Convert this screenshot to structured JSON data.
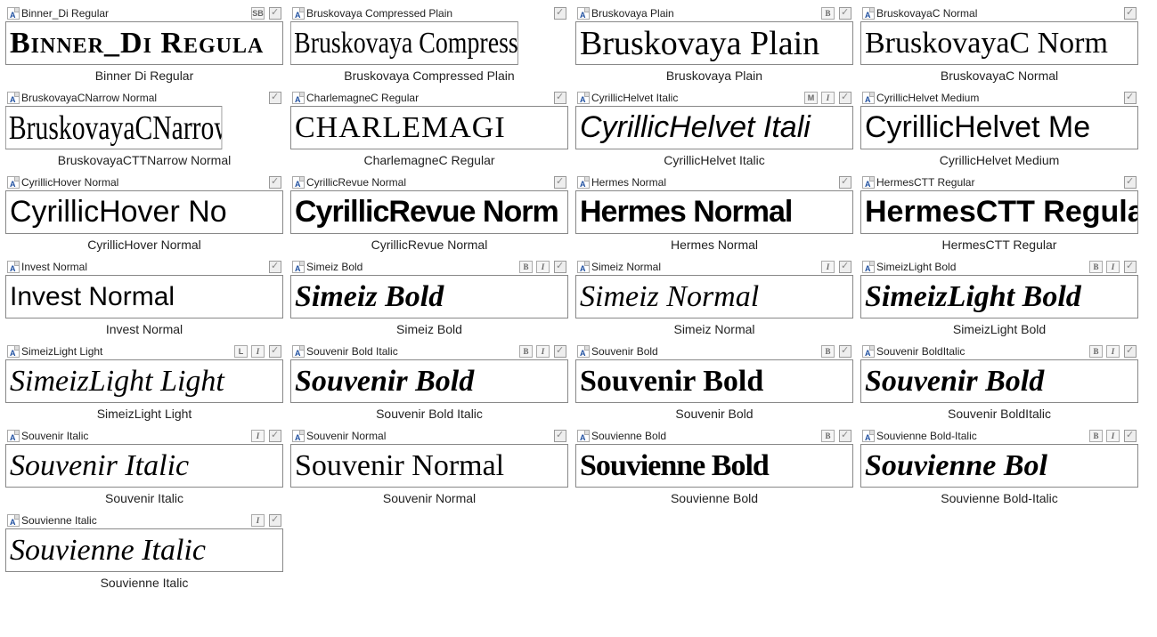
{
  "fonts": [
    {
      "title": "Binner_Di Regular",
      "preview": "Binner_Di Regula",
      "caption": "Binner Di Regular",
      "cls": "f-binner",
      "badges": [
        "SB"
      ]
    },
    {
      "title": "Bruskovaya Compressed Plain",
      "preview": "Bruskovaya Compressed Pla",
      "caption": "Bruskovaya Compressed Plain",
      "cls": "f-bruskcomp",
      "badges": []
    },
    {
      "title": "Bruskovaya Plain",
      "preview": "Bruskovaya Plain",
      "caption": "Bruskovaya Plain",
      "cls": "f-brusk",
      "badges": [
        "B"
      ]
    },
    {
      "title": "BruskovayaC Normal",
      "preview": "BruskovayaC Norm",
      "caption": "BruskovayaC Normal",
      "cls": "f-bruskc",
      "badges": []
    },
    {
      "title": "BruskovayaCNarrow Normal",
      "preview": "BruskovayaCNarrow Norma",
      "caption": "BruskovayaCTTNarrow Normal",
      "cls": "f-brusknarrow",
      "badges": []
    },
    {
      "title": "CharlemagneC Regular",
      "preview": "CHARLEMAGI",
      "caption": "CharlemagneC Regular",
      "cls": "f-charle",
      "badges": []
    },
    {
      "title": "CyrillicHelvet Italic",
      "preview": "CyrillicHelvet Itali",
      "caption": "CyrillicHelvet Italic",
      "cls": "f-helvet-i",
      "badges": [
        "M",
        "I"
      ]
    },
    {
      "title": "CyrillicHelvet Medium",
      "preview": "CyrillicHelvet Me",
      "caption": "CyrillicHelvet Medium",
      "cls": "f-helvet-m",
      "badges": []
    },
    {
      "title": "CyrillicHover Normal",
      "preview": "CyrillicHover No",
      "caption": "CyrillicHover Normal",
      "cls": "f-hover",
      "badges": []
    },
    {
      "title": "CyrillicRevue Normal",
      "preview": "CyrillicRevue Norm",
      "caption": "CyrillicRevue Normal",
      "cls": "f-revue",
      "badges": []
    },
    {
      "title": "Hermes Normal",
      "preview": "Hermes Normal",
      "caption": "Hermes Normal",
      "cls": "f-hermes",
      "badges": []
    },
    {
      "title": "HermesCTT Regular",
      "preview": "HermesCTT Regular",
      "caption": "HermesCTT Regular",
      "cls": "f-hermes-ctt",
      "badges": []
    },
    {
      "title": "Invest Normal",
      "preview": "Invest   Normal",
      "caption": "Invest Normal",
      "cls": "f-invest",
      "badges": []
    },
    {
      "title": "Simeiz Bold",
      "preview": "Simeiz  Bold",
      "caption": "Simeiz Bold",
      "cls": "f-simeiz-b",
      "badges": [
        "B",
        "I"
      ]
    },
    {
      "title": "Simeiz Normal",
      "preview": "Simeiz  Normal",
      "caption": "Simeiz Normal",
      "cls": "f-simeiz",
      "badges": [
        "I"
      ]
    },
    {
      "title": "SimeizLight Bold",
      "preview": "SimeizLight  Bold",
      "caption": "SimeizLight Bold",
      "cls": "f-simeizl-b",
      "badges": [
        "B",
        "I"
      ]
    },
    {
      "title": "SimeizLight Light",
      "preview": "SimeizLight  Light",
      "caption": "SimeizLight Light",
      "cls": "f-simeizl-l",
      "badges": [
        "L",
        "I"
      ]
    },
    {
      "title": "Souvenir Bold Italic",
      "preview": "Souvenir  Bold",
      "caption": "Souvenir Bold Italic",
      "cls": "f-souv-bi",
      "badges": [
        "B",
        "I"
      ]
    },
    {
      "title": "Souvenir Bold",
      "preview": "Souvenir Bold",
      "caption": "Souvenir Bold",
      "cls": "f-souv-b",
      "badges": [
        "B"
      ]
    },
    {
      "title": "Souvenir BoldItalic",
      "preview": "Souvenir Bold",
      "caption": "Souvenir BoldItalic",
      "cls": "f-souv-bi2",
      "badges": [
        "B",
        "I"
      ]
    },
    {
      "title": "Souvenir Italic",
      "preview": "Souvenir Italic",
      "caption": "Souvenir Italic",
      "cls": "f-souv-i",
      "badges": [
        "I"
      ]
    },
    {
      "title": "Souvenir Normal",
      "preview": "Souvenir Normal",
      "caption": "Souvenir Normal",
      "cls": "f-souv-n",
      "badges": []
    },
    {
      "title": "Souvienne Bold",
      "preview": "Souvienne Bold",
      "caption": "Souvienne Bold",
      "cls": "f-souvi-b",
      "badges": [
        "B"
      ]
    },
    {
      "title": "Souvienne Bold-Italic",
      "preview": "Souvienne Bol",
      "caption": "Souvienne Bold-Italic",
      "cls": "f-souvi-bi",
      "badges": [
        "B",
        "I"
      ]
    },
    {
      "title": "Souvienne Italic",
      "preview": "Souvienne Italic",
      "caption": "Souvienne Italic",
      "cls": "f-souvi-i",
      "badges": [
        "I"
      ]
    }
  ]
}
